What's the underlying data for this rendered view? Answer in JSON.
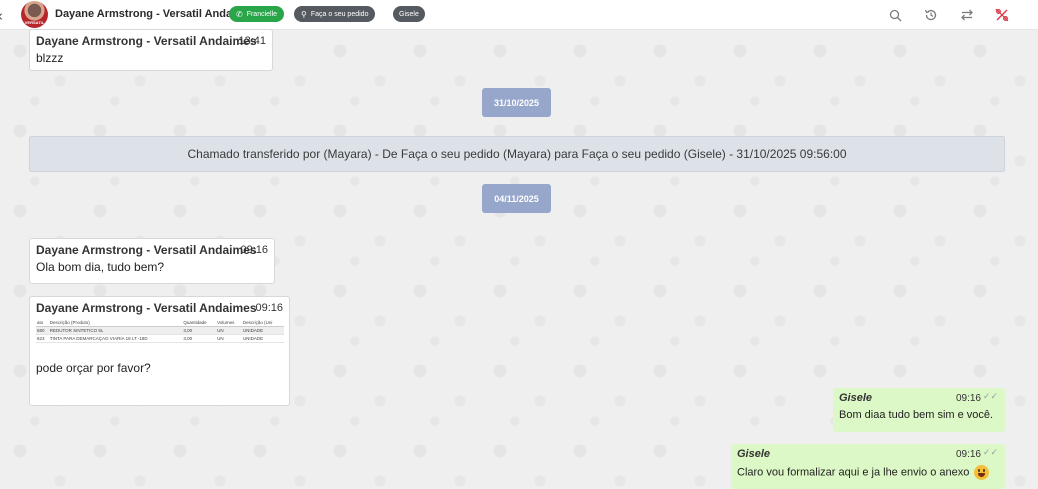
{
  "header": {
    "contact_name": "Dayane Armstrong - Versatil Andaimes",
    "avatar_brand": "VERSATIL",
    "tags": [
      {
        "label": "Francielle",
        "icon": "whatsapp-icon",
        "color": "#2aa64a"
      },
      {
        "label": "Faça o seu pedido",
        "icon": "sitemap-icon",
        "color": "#555a60"
      },
      {
        "label": "Gisele",
        "color": "#555a60"
      }
    ],
    "icons": [
      "search-icon",
      "history-icon",
      "transfer-icon",
      "close-percent-icon"
    ]
  },
  "messages": {
    "m1": {
      "author": "Dayane Armstrong - Versatil Andaimes",
      "time": "13:41",
      "text": "blzzz"
    },
    "date1": "31/10/2025",
    "system": "Chamado transferido por (Mayara) - De Faça o seu pedido (Mayara) para Faça o seu pedido (Gisele) - 31/10/2025 09:56:00",
    "date2": "04/11/2025",
    "m2": {
      "author": "Dayane Armstrong - Versatil Andaimes",
      "time": "09:16",
      "text": "Ola bom dia, tudo bem?"
    },
    "m3": {
      "author": "Dayane Armstrong - Versatil Andaimes",
      "time": "09:16",
      "table": {
        "headers": [
          "ato",
          "Descrição (Produto)",
          "Quantidade",
          "Volumes",
          "Descrição (Uni"
        ],
        "rows": [
          [
            "680",
            "REDUTOR SINTETICO 5L",
            "3,00",
            "UN",
            "UNIDADE"
          ],
          [
            "623",
            "TINTA PARA DEMARCAÇAO VIARIA 18 LT -18D",
            "3,00",
            "UN",
            "UNIDADE"
          ]
        ]
      },
      "text": "pode orçar por favor?"
    },
    "o1": {
      "author": "Gisele",
      "time": "09:16",
      "text": "Bom diaa tudo bem sim e você."
    },
    "o2": {
      "author": "Gisele",
      "time": "09:16",
      "text": "Claro vou formalizar aqui e ja lhe envio o anexo"
    }
  },
  "colors": {
    "outgoing": "#dcf8c6",
    "date_chip": "#97a6cb",
    "system_bg": "#dde1e8",
    "close_icon": "#d93a4a"
  }
}
